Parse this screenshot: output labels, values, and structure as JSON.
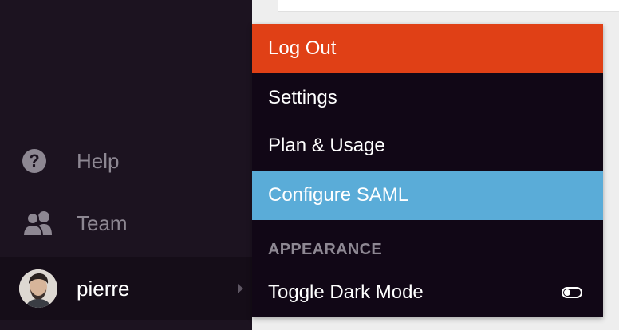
{
  "sidebar": {
    "items": [
      {
        "label": "Help",
        "icon": "question-circle-icon"
      },
      {
        "label": "Team",
        "icon": "users-icon"
      }
    ],
    "user": {
      "name": "pierre",
      "avatar": "avatar"
    }
  },
  "menu": {
    "items": [
      {
        "label": "Log Out"
      },
      {
        "label": "Settings"
      },
      {
        "label": "Plan & Usage"
      },
      {
        "label": "Configure SAML"
      }
    ],
    "appearance": {
      "header": "APPEARANCE",
      "toggle_label": "Toggle Dark Mode",
      "toggle_on": false
    }
  },
  "colors": {
    "sidebar_bg": "#1c1320",
    "menu_bg": "#110716",
    "logout_bg": "#e04016",
    "highlight_bg": "#5aacd8"
  }
}
